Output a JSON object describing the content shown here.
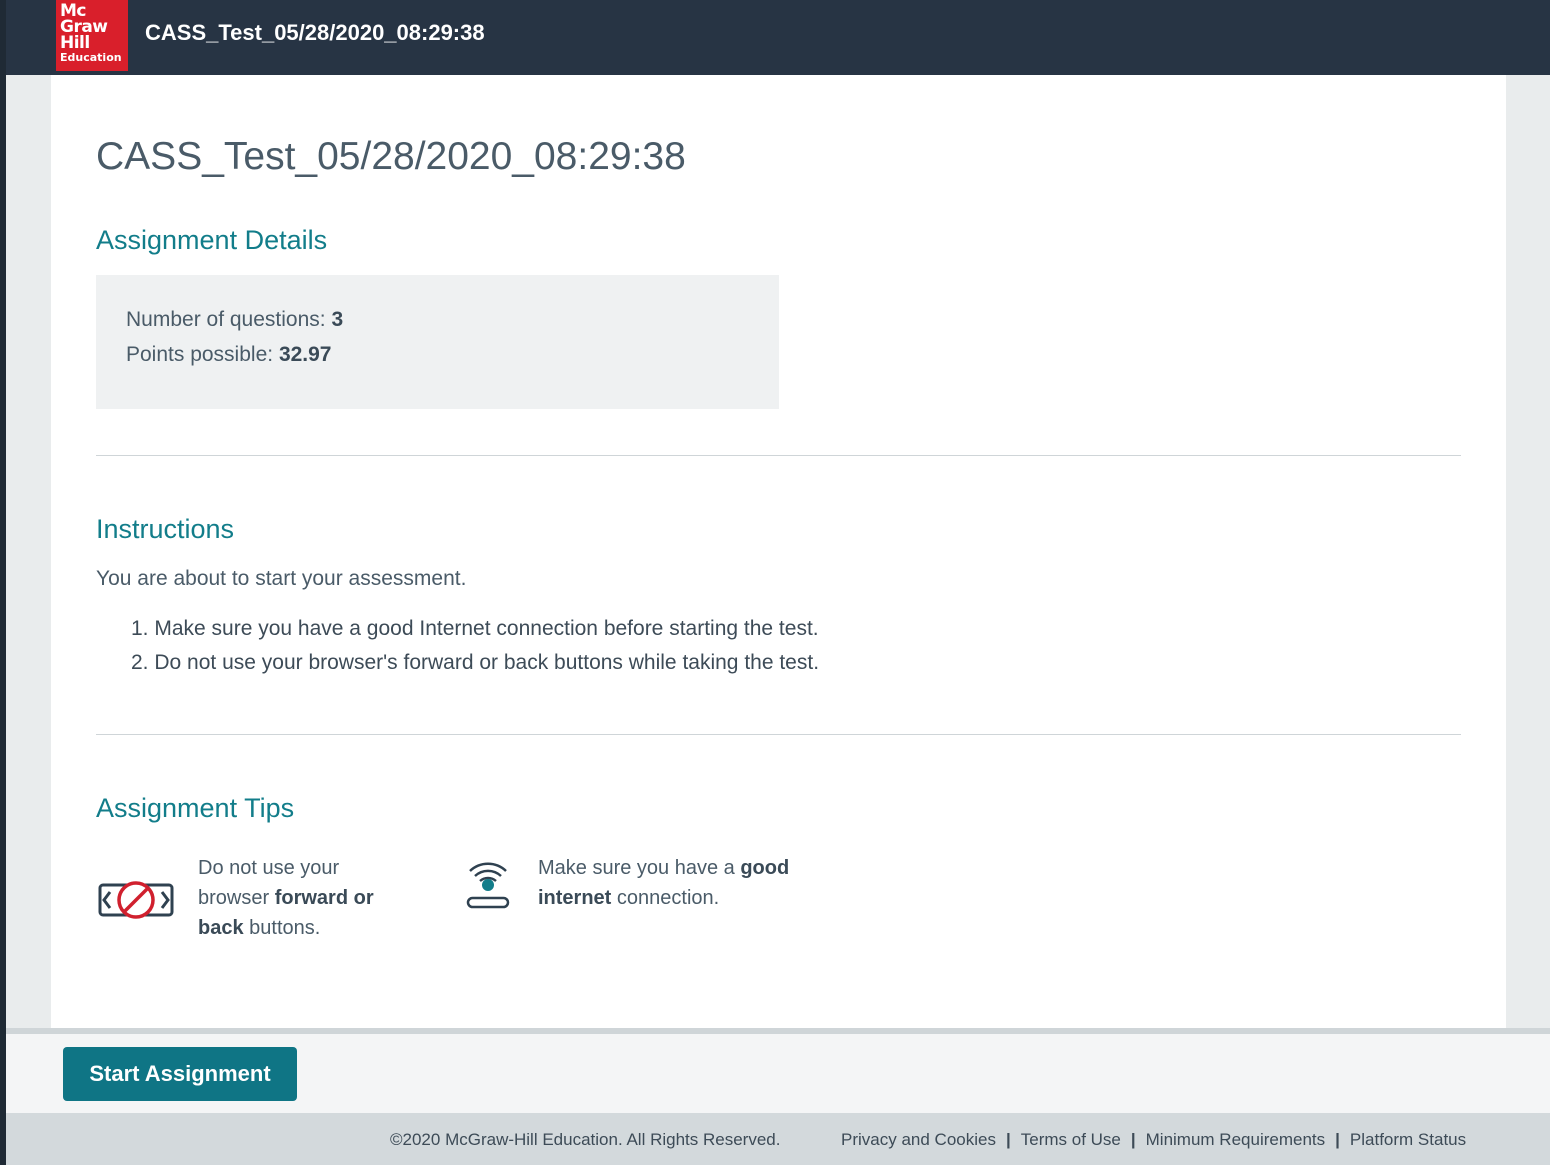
{
  "header": {
    "logo_lines": [
      "Mc",
      "Graw",
      "Hill",
      "Education"
    ],
    "title": "CASS_Test_05/28/2020_08:29:38"
  },
  "main": {
    "page_title": "CASS_Test_05/28/2020_08:29:38",
    "details": {
      "heading": "Assignment Details",
      "questions_label": "Number of questions:",
      "questions_value": "3",
      "points_label": "Points possible:",
      "points_value": "32.97"
    },
    "instructions": {
      "heading": "Instructions",
      "intro": "You are about to start your assessment.",
      "items": [
        "Make sure you have a good Internet connection before starting the test.",
        "Do not use your browser's forward or back buttons while taking the test."
      ],
      "numbers": [
        "1.",
        "2."
      ]
    },
    "tips": {
      "heading": "Assignment Tips",
      "tip1": {
        "icon": "no-navigation-icon",
        "pre": "Do not use your browser ",
        "bold": "forward or back",
        "post": " buttons."
      },
      "tip2": {
        "icon": "wifi-icon",
        "pre": "Make sure you have a ",
        "bold": "good internet",
        "post": " connection."
      }
    }
  },
  "actions": {
    "start_label": "Start Assignment"
  },
  "footer": {
    "copyright": "©2020 McGraw-Hill Education. All Rights Reserved.",
    "links": [
      "Privacy and Cookies",
      "Terms of Use",
      "Minimum Requirements",
      "Platform Status"
    ],
    "separator": "|"
  },
  "colors": {
    "header_bg": "#273444",
    "brand_red": "#d91f2b",
    "accent_teal": "#127d8a",
    "button_bg": "#0f7585",
    "icon_red": "#d0202e"
  }
}
